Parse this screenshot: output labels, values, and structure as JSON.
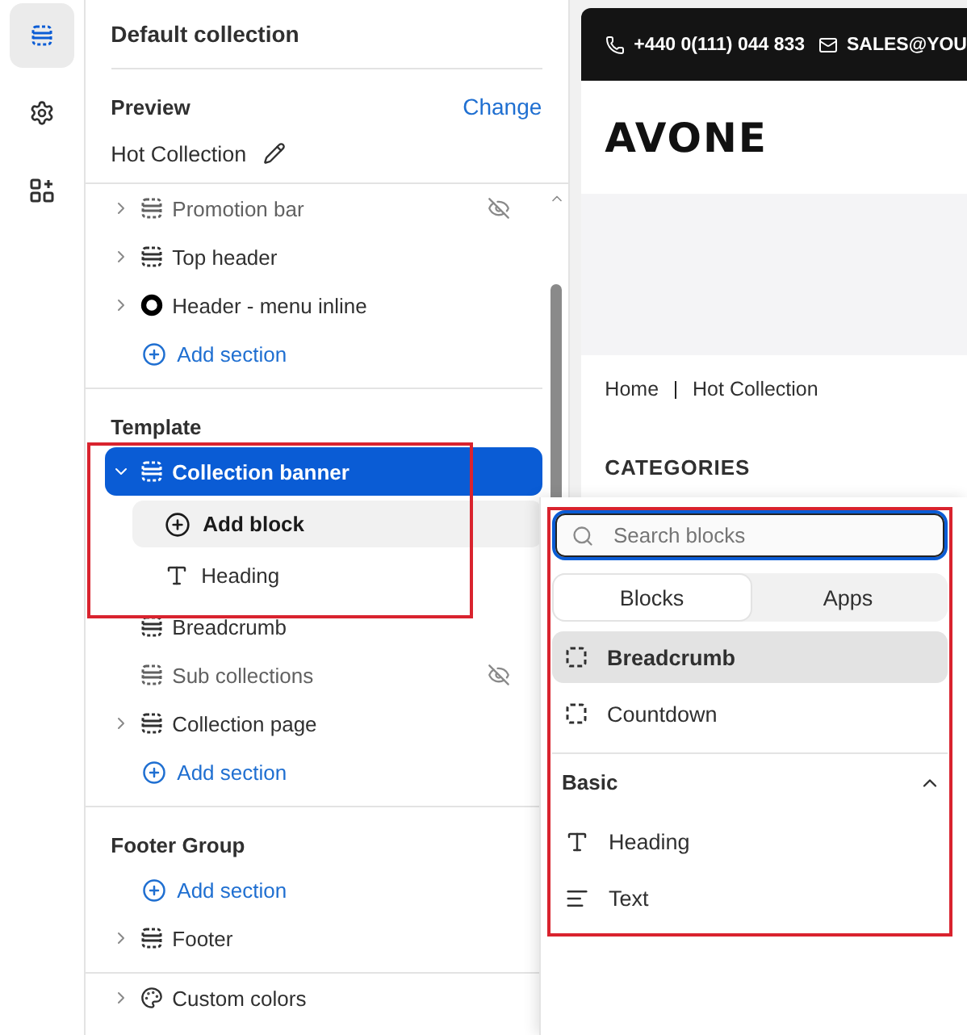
{
  "rail": [
    {
      "kind": "sections",
      "selected": true
    },
    {
      "kind": "settings",
      "selected": false
    },
    {
      "kind": "apps",
      "selected": false
    }
  ],
  "panel": {
    "title": "Default collection",
    "preview": {
      "label": "Preview",
      "action": "Change",
      "value": "Hot Collection"
    },
    "groups": [
      {
        "items": [
          {
            "kind": "section",
            "label": "Promotion bar",
            "expandable": true,
            "expanded": false,
            "hidden": true
          },
          {
            "kind": "section",
            "label": "Top header",
            "expandable": true,
            "expanded": false,
            "hidden": false
          },
          {
            "kind": "app",
            "label": "Header - menu inline",
            "expandable": true,
            "expanded": false,
            "hidden": false
          },
          {
            "kind": "add",
            "label": "Add section"
          }
        ]
      },
      {
        "title": "Template",
        "items": [
          {
            "kind": "section",
            "label": "Collection banner",
            "expandable": true,
            "expanded": true,
            "selected": true,
            "outlined": true,
            "hidden": false,
            "children": [
              {
                "kind": "add_block",
                "label": "Add block"
              },
              {
                "kind": "text_block",
                "label": "Heading"
              }
            ]
          },
          {
            "kind": "section",
            "label": "Breadcrumb",
            "expandable": false,
            "hidden": false
          },
          {
            "kind": "section",
            "label": "Sub collections",
            "expandable": false,
            "hidden": true
          },
          {
            "kind": "section",
            "label": "Collection page",
            "expandable": true,
            "expanded": false,
            "hidden": false
          },
          {
            "kind": "add",
            "label": "Add section"
          }
        ]
      },
      {
        "title": "Footer Group",
        "items": [
          {
            "kind": "add",
            "label": "Add section"
          },
          {
            "kind": "footer",
            "label": "Footer",
            "expandable": true,
            "expanded": false,
            "hidden": false
          }
        ]
      },
      {
        "items": [
          {
            "kind": "settings",
            "label": "Custom colors",
            "expandable": true,
            "expanded": false,
            "hidden": false
          }
        ]
      }
    ]
  },
  "preview": {
    "phone": "+440 0(111) 044 833",
    "email": "SALES@YOU",
    "logo": "AVONE",
    "breadcrumb": [
      "Home",
      "Hot Collection"
    ],
    "heading": "CATEGORIES"
  },
  "popover": {
    "outlined": true,
    "search": {
      "placeholder": "Search blocks"
    },
    "tabs": [
      {
        "label": "Blocks",
        "selected": true
      },
      {
        "label": "Apps",
        "selected": false
      }
    ],
    "items": [
      {
        "kind": "block",
        "label": "Breadcrumb",
        "selected": true
      },
      {
        "kind": "block",
        "label": "Countdown",
        "selected": false
      }
    ],
    "sections": [
      {
        "title": "Basic",
        "expanded": true,
        "items": [
          {
            "kind": "heading",
            "label": "Heading",
            "selected": false
          },
          {
            "kind": "text",
            "label": "Text",
            "selected": false
          }
        ]
      }
    ]
  }
}
